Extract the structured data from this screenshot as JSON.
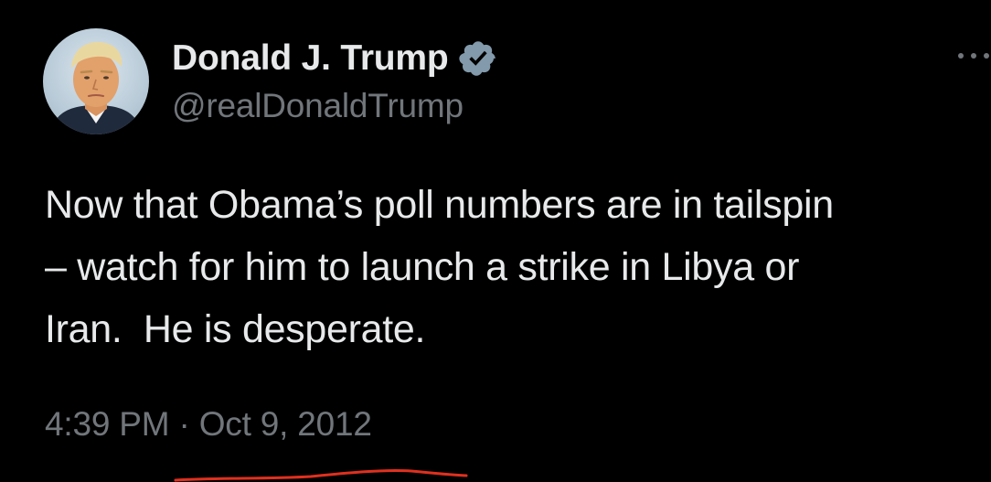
{
  "tweet": {
    "author": {
      "display_name": "Donald J. Trump",
      "handle": "@realDonaldTrump",
      "verified": true,
      "verified_icon": "verified-badge-icon"
    },
    "text_lines": [
      "Now that Obama’s poll numbers are in tailspin",
      "– watch for him to launch a strike in Libya or",
      "Iran.  He is desperate."
    ],
    "time": "4:39 PM",
    "separator": "·",
    "date": "Oct 9, 2012",
    "more_icon": "more-options-icon"
  },
  "colors": {
    "background": "#000000",
    "primary_text": "#e7e9ea",
    "secondary_text": "#71767b",
    "annotation_stroke": "#e0301e"
  }
}
